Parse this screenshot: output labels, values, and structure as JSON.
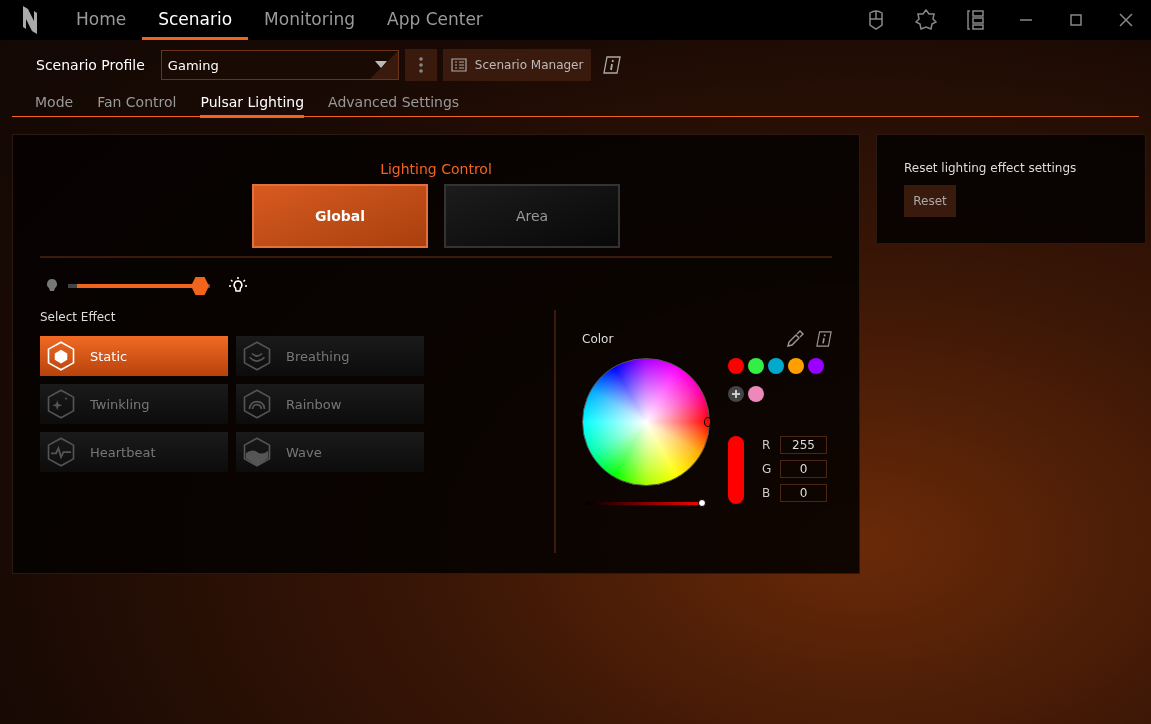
{
  "nav": {
    "tabs": [
      {
        "label": "Home",
        "selected": false
      },
      {
        "label": "Scenario",
        "selected": true
      },
      {
        "label": "Monitoring",
        "selected": false
      },
      {
        "label": "App Center",
        "selected": false
      }
    ]
  },
  "profile": {
    "label": "Scenario Profile",
    "value": "Gaming",
    "manager": "Scenario Manager"
  },
  "subtabs": [
    {
      "label": "Mode",
      "selected": false
    },
    {
      "label": "Fan Control",
      "selected": false
    },
    {
      "label": "Pulsar Lighting",
      "selected": true
    },
    {
      "label": "Advanced Settings",
      "selected": false
    }
  ],
  "lighting": {
    "title": "Lighting Control",
    "modes": [
      {
        "label": "Global",
        "selected": true
      },
      {
        "label": "Area",
        "selected": false
      }
    ],
    "brightness": {
      "level": 1
    },
    "effect_title": "Select Effect",
    "effects": [
      {
        "label": "Static",
        "selected": true
      },
      {
        "label": "Breathing",
        "selected": false
      },
      {
        "label": "Twinkling",
        "selected": false
      },
      {
        "label": "Rainbow",
        "selected": false
      },
      {
        "label": "Heartbeat",
        "selected": false
      },
      {
        "label": "Wave",
        "selected": false
      }
    ]
  },
  "color": {
    "title": "Color",
    "swatches": [
      {
        "color": "#ff0000"
      },
      {
        "color": "#33ee44"
      },
      {
        "color": "#00aacc"
      },
      {
        "color": "#ffa000"
      },
      {
        "color": "#9900ff"
      },
      {
        "color": "#ee88bb"
      }
    ],
    "intensity": {
      "level": 1
    },
    "channels": [
      {
        "label": "R",
        "value": "255"
      },
      {
        "label": "G",
        "value": "0"
      },
      {
        "label": "B",
        "value": "0"
      }
    ]
  },
  "reset": {
    "text": "Reset lighting effect settings",
    "button": "Reset"
  }
}
